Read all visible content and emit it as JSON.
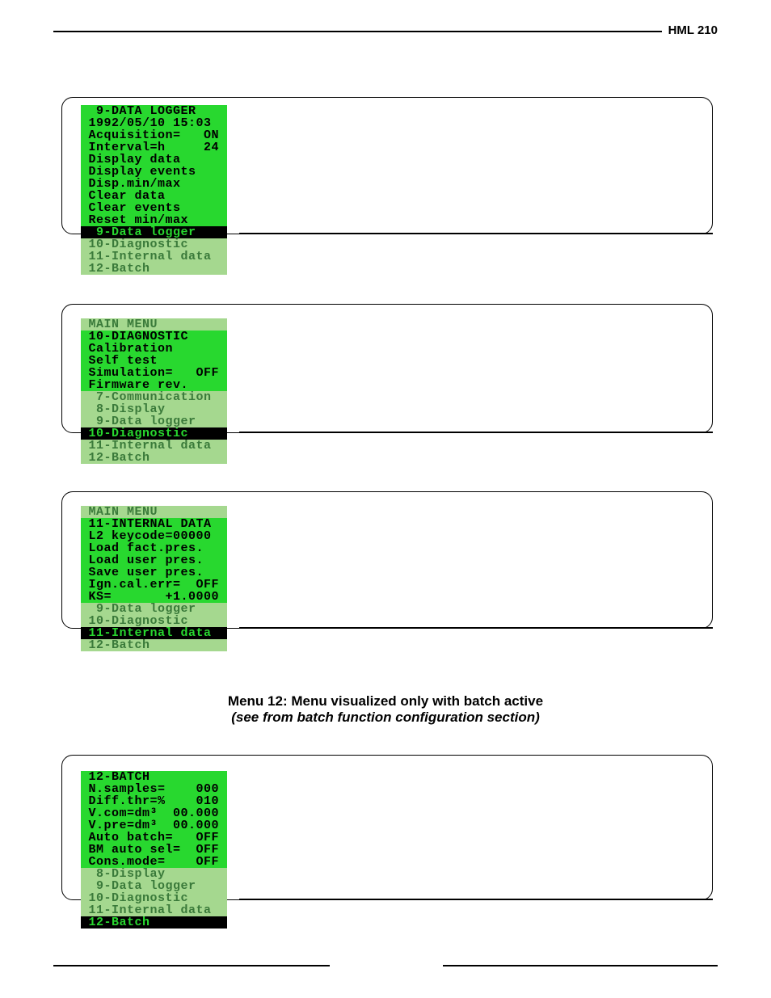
{
  "header": {
    "model": "HML 210"
  },
  "caption": {
    "line1": "Menu 12: Menu visualized only with batch active",
    "line2": "(see from batch function configuration section)"
  },
  "screens": {
    "s9": {
      "bright": [
        "  9-DATA LOGGER    ",
        " 1992/05/10 15:03  ",
        " Acquisition=   ON ",
        " Interval=h     24 ",
        " Display data      ",
        " Display events    ",
        " Disp.min/max      ",
        " Clear data        ",
        " Clear events      ",
        " Reset min/max     "
      ],
      "hl": "  9-Data logger    ",
      "dim": [
        " 10-Diagnostic     ",
        " 11-Internal data  ",
        " 12-Batch          "
      ]
    },
    "s10": {
      "dim_top": [
        " MAIN MENU         "
      ],
      "bright": [
        " 10-DIAGNOSTIC     ",
        " Calibration       ",
        " Self test         ",
        " Simulation=   OFF ",
        " Firmware rev.     "
      ],
      "dim_mid": [
        "  7-Communication  ",
        "  8-Display        ",
        "  9-Data logger    "
      ],
      "hl": " 10-Diagnostic     ",
      "dim_bot": [
        " 11-Internal data  ",
        " 12-Batch          "
      ]
    },
    "s11": {
      "dim_top": [
        " MAIN MENU         "
      ],
      "bright": [
        " 11-INTERNAL DATA  ",
        " L2 keycode=00000  ",
        " Load fact.pres.   ",
        " Load user pres.   ",
        " Save user pres.   ",
        " Ign.cal.err=  OFF ",
        " KS=       +1.0000 "
      ],
      "dim_mid": [
        "  9-Data logger    ",
        " 10-Diagnostic     "
      ],
      "hl": " 11-Internal data  ",
      "dim_bot": [
        " 12-Batch          "
      ]
    },
    "s12": {
      "bright": [
        " 12-BATCH          ",
        " N.samples=    000 ",
        " Diff.thr=%    010 ",
        " V.com=dm³  00.000 ",
        " V.pre=dm³  00.000 ",
        " Auto batch=   OFF ",
        " BM auto sel=  OFF ",
        " Cons.mode=    OFF "
      ],
      "dim": [
        "  8-Display        ",
        "  9-Data logger    ",
        " 10-Diagnostic     ",
        " 11-Internal data  "
      ],
      "hl": " 12-Batch          "
    }
  }
}
